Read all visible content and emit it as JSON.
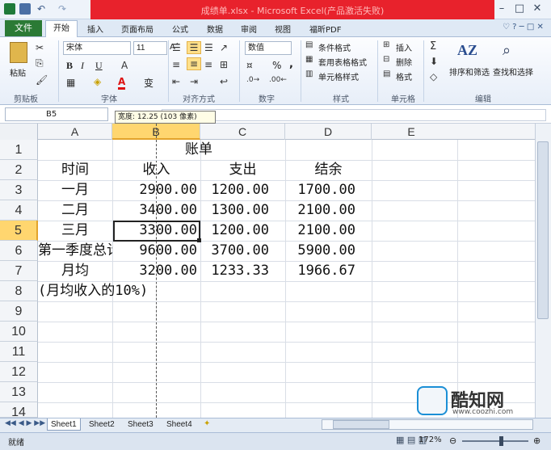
{
  "window": {
    "title": "成绩单.xlsx - Microsoft Excel(产品激活失败)"
  },
  "tabs": {
    "file": "文件",
    "items": [
      "开始",
      "插入",
      "页面布局",
      "公式",
      "数据",
      "审阅",
      "视图",
      "福昕PDF"
    ]
  },
  "ribbon": {
    "clipboard": {
      "paste": "粘贴",
      "label": "剪贴板"
    },
    "font": {
      "name": "宋体",
      "size": "11",
      "label": "字体",
      "bold": "B",
      "italic": "I",
      "underline": "U",
      "font_color": "A",
      "wen": "变"
    },
    "alignment": {
      "label": "对齐方式"
    },
    "number": {
      "format": "数值",
      "percent": "%",
      "comma": ",",
      "label": "数字"
    },
    "styles": {
      "conditional": "条件格式",
      "table": "套用表格格式",
      "cell_styles": "单元格样式",
      "label": "样式"
    },
    "cells": {
      "insert": "插入",
      "delete": "删除",
      "format": "格式",
      "label": "单元格"
    },
    "editing": {
      "sort": "排序和筛选",
      "find": "查找和选择",
      "label": "编辑"
    }
  },
  "formula_bar": {
    "name_box": "B5",
    "fx": "fx",
    "tooltip": "宽度: 12.25 (103 像素)"
  },
  "columns": [
    "A",
    "B",
    "C",
    "D",
    "E"
  ],
  "rows": [
    "1",
    "2",
    "3",
    "4",
    "5",
    "6",
    "7",
    "8",
    "9",
    "10",
    "11",
    "12",
    "13",
    "14"
  ],
  "sheet": {
    "title": "账单",
    "headers": [
      "时间",
      "收入",
      "支出",
      "结余"
    ],
    "data": [
      [
        "一月",
        "2900.00",
        "1200.00",
        "1700.00"
      ],
      [
        "二月",
        "3400.00",
        "1300.00",
        "2100.00"
      ],
      [
        "三月",
        "3300.00",
        "1200.00",
        "2100.00"
      ],
      [
        "第一季度总计",
        "9600.00",
        "3700.00",
        "5900.00"
      ],
      [
        "月均",
        "3200.00",
        "1233.33",
        "1966.67"
      ]
    ],
    "note": "(月均收入的10%)"
  },
  "sheet_tabs": [
    "Sheet1",
    "Sheet2",
    "Sheet3",
    "Sheet4"
  ],
  "status": {
    "ready": "就绪",
    "zoom": "172%"
  },
  "watermark": {
    "name": "酷知网",
    "url": "www.coozhi.com"
  },
  "colors": {
    "title_red": "#e8222c",
    "file_green": "#2b7a35",
    "selection": "#222222"
  }
}
